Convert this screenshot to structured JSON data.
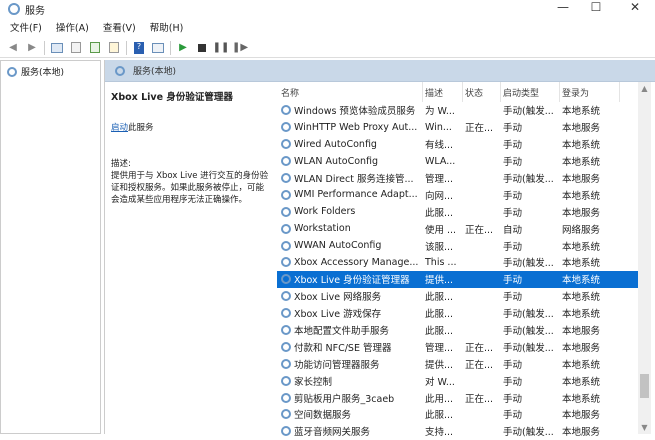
{
  "window": {
    "title": "服务",
    "minimize": "—",
    "maximize": "☐",
    "close": "✕"
  },
  "menu": [
    "文件(F)",
    "操作(A)",
    "查看(V)",
    "帮助(H)"
  ],
  "tree": {
    "root": "服务(本地)"
  },
  "pane": {
    "header": "服务(本地)"
  },
  "details": {
    "title": "Xbox Live 身份验证管理器",
    "start_link": "启动",
    "start_suffix": "此服务",
    "desc_label": "描述:",
    "desc_text": "提供用于与 Xbox Live 进行交互的身份验证和授权服务。如果此服务被停止，可能会造成某些应用程序无法正确操作。"
  },
  "columns": [
    "名称",
    "描述",
    "状态",
    "启动类型",
    "登录为"
  ],
  "rows": [
    [
      "Windows 预览体验成员服务",
      "为 W...",
      "",
      "手动(触发...",
      "本地系统"
    ],
    [
      "WinHTTP Web Proxy Aut...",
      "Win...",
      "正在...",
      "手动",
      "本地服务"
    ],
    [
      "Wired AutoConfig",
      "有线...",
      "",
      "手动",
      "本地系统"
    ],
    [
      "WLAN AutoConfig",
      "WLA...",
      "",
      "手动",
      "本地系统"
    ],
    [
      "WLAN Direct 服务连接管...",
      "管理...",
      "",
      "手动(触发...",
      "本地服务"
    ],
    [
      "WMI Performance Adapt...",
      "向网...",
      "",
      "手动",
      "本地系统"
    ],
    [
      "Work Folders",
      "此服...",
      "",
      "手动",
      "本地服务"
    ],
    [
      "Workstation",
      "使用 ...",
      "正在...",
      "自动",
      "网络服务"
    ],
    [
      "WWAN AutoConfig",
      "该服...",
      "",
      "手动",
      "本地系统"
    ],
    [
      "Xbox Accessory Manage...",
      "This ...",
      "",
      "手动(触发...",
      "本地系统"
    ],
    [
      "Xbox Live 身份验证管理器",
      "提供...",
      "",
      "手动",
      "本地系统"
    ],
    [
      "Xbox Live 网络服务",
      "此服...",
      "",
      "手动",
      "本地系统"
    ],
    [
      "Xbox Live 游戏保存",
      "此服...",
      "",
      "手动(触发...",
      "本地系统"
    ],
    [
      "本地配置文件助手服务",
      "此服...",
      "",
      "手动(触发...",
      "本地服务"
    ],
    [
      "付款和 NFC/SE 管理器",
      "管理...",
      "正在...",
      "手动(触发...",
      "本地服务"
    ],
    [
      "功能访问管理器服务",
      "提供...",
      "正在...",
      "手动",
      "本地系统"
    ],
    [
      "家长控制",
      "对 W...",
      "",
      "手动",
      "本地系统"
    ],
    [
      "剪贴板用户服务_3caeb",
      "此用...",
      "正在...",
      "手动",
      "本地系统"
    ],
    [
      "空间数据服务",
      "此服...",
      "",
      "手动",
      "本地服务"
    ],
    [
      "蓝牙音频网关服务",
      "支持...",
      "",
      "手动(触发...",
      "本地服务"
    ]
  ],
  "selected_index": 10
}
